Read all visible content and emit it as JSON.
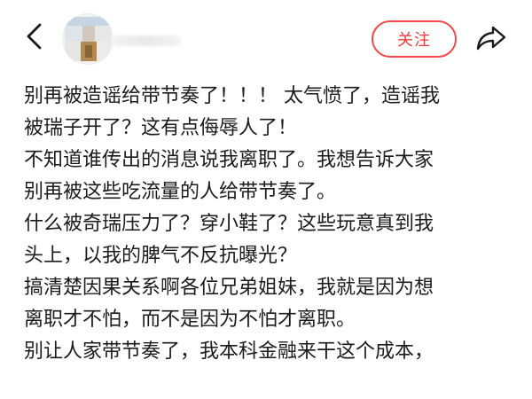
{
  "header": {
    "follow_label": "关注",
    "username": ""
  },
  "icons": {
    "back": "chevron-left-icon",
    "share": "share-arrow-icon"
  },
  "colors": {
    "accent": "#ef3b3b",
    "text": "#1b1b1b",
    "icon": "#1a1a1a",
    "background": "#ffffff"
  },
  "post": {
    "lines": [
      "别再被造谣给带节奏了！！！ 太气愤了，造谣我",
      "被瑞子开了？这有点侮辱人了！",
      "不知道谁传出的消息说我离职了。我想告诉大家",
      "别再被这些吃流量的人给带节奏了。",
      "什么被奇瑞压力了？穿小鞋了？这些玩意真到我",
      "头上，以我的脾气不反抗曝光？",
      "搞清楚因果关系啊各位兄弟姐妹，我就是因为想",
      "离职才不怕，而不是因为不怕才离职。",
      "别让人家带节奏了，我本科金融来干这个成本，"
    ]
  }
}
